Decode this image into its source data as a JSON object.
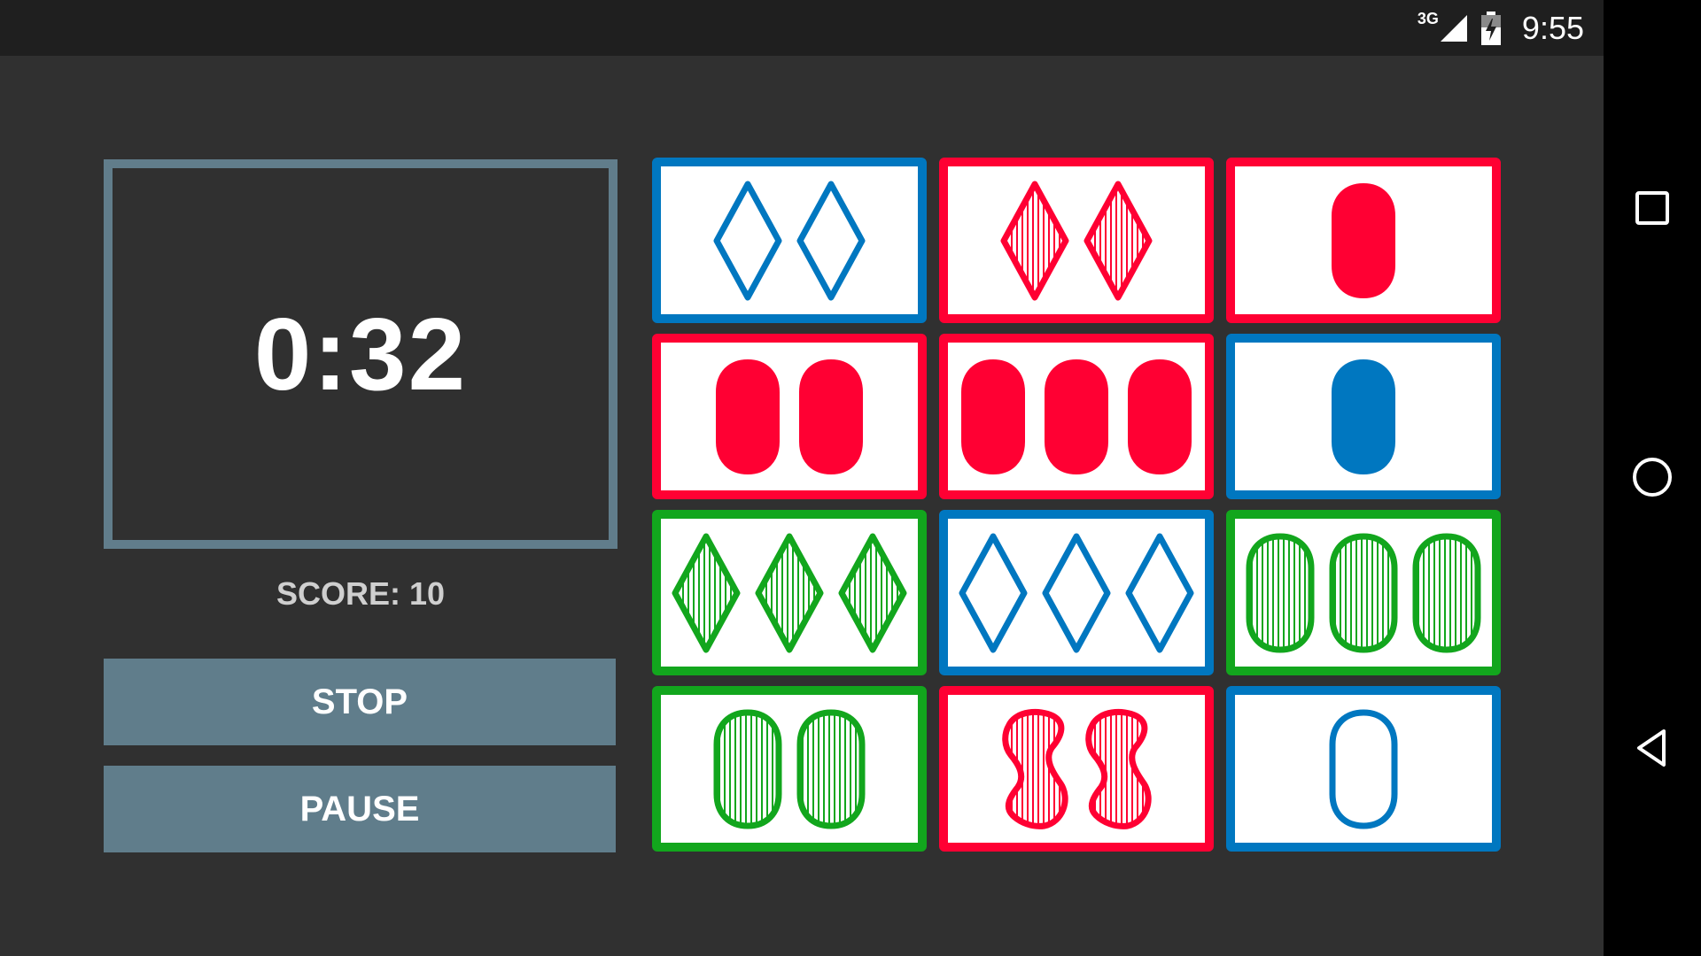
{
  "status_bar": {
    "network": "3G",
    "time": "9:55",
    "signal_icon": "signal-icon",
    "battery_icon": "battery-charging-icon"
  },
  "navigation": {
    "overview_icon": "square-icon",
    "home_icon": "circle-icon",
    "back_icon": "back-triangle-icon"
  },
  "game": {
    "timer": "0:32",
    "score_label": "SCORE: 10",
    "stop_label": "STOP",
    "pause_label": "PAUSE"
  },
  "colors": {
    "red": "#ff0033",
    "blue": "#0077c0",
    "green": "#12a61d",
    "timer_border": "#617d8b",
    "button": "#607d8b"
  },
  "cards": [
    {
      "count": 2,
      "shape": "diamond",
      "fill": "empty",
      "color": "blue"
    },
    {
      "count": 2,
      "shape": "diamond",
      "fill": "striped",
      "color": "red"
    },
    {
      "count": 1,
      "shape": "oval",
      "fill": "solid",
      "color": "red"
    },
    {
      "count": 2,
      "shape": "oval",
      "fill": "solid",
      "color": "red"
    },
    {
      "count": 3,
      "shape": "oval",
      "fill": "solid",
      "color": "red"
    },
    {
      "count": 1,
      "shape": "oval",
      "fill": "solid",
      "color": "blue"
    },
    {
      "count": 3,
      "shape": "diamond",
      "fill": "striped",
      "color": "green"
    },
    {
      "count": 3,
      "shape": "diamond",
      "fill": "empty",
      "color": "blue"
    },
    {
      "count": 3,
      "shape": "oval",
      "fill": "striped",
      "color": "green"
    },
    {
      "count": 2,
      "shape": "oval",
      "fill": "striped",
      "color": "green"
    },
    {
      "count": 2,
      "shape": "squiggle",
      "fill": "striped",
      "color": "red"
    },
    {
      "count": 1,
      "shape": "oval",
      "fill": "empty",
      "color": "blue"
    }
  ]
}
